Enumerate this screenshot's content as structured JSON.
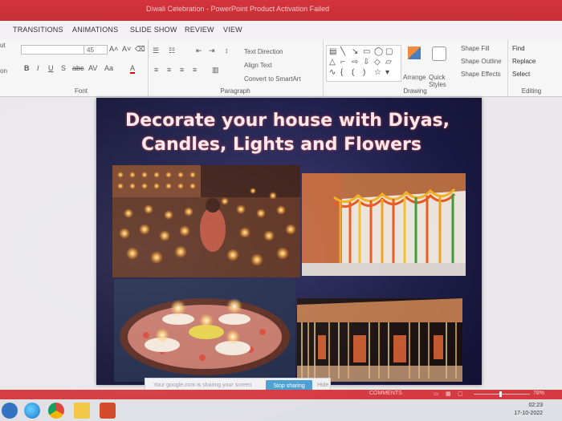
{
  "titlebar": {
    "title": "Diwali Celebration - PowerPoint Product Activation Failed"
  },
  "tabs": [
    "TRANSITIONS",
    "ANIMATIONS",
    "SLIDE SHOW",
    "REVIEW",
    "VIEW"
  ],
  "window": {
    "help": "?",
    "restore": "▢"
  },
  "ribbon": {
    "font": {
      "label": "Font",
      "font_size": "45",
      "buttons": [
        "B",
        "I",
        "U",
        "S",
        "abc",
        "AV",
        "Aa",
        "A"
      ],
      "grow": "A˄",
      "shrink": "A˅"
    },
    "paragraph": {
      "label": "Paragraph",
      "text_direction": "Text Direction",
      "align_text": "Align Text",
      "convert_smartart": "Convert to SmartArt"
    },
    "drawing": {
      "label": "Drawing",
      "arrange": "Arrange",
      "quick_styles": "Quick Styles",
      "shape_fill": "Shape Fill",
      "shape_outline": "Shape Outline",
      "shape_effects": "Shape Effects"
    },
    "editing": {
      "label": "Editing",
      "find": "Find",
      "replace": "Replace",
      "select": "Select"
    },
    "left_cut": [
      "ut",
      "on"
    ]
  },
  "slide": {
    "title_line1": "Decorate your house with Diyas,",
    "title_line2": "Candles, Lights and Flowers",
    "colors": {
      "background": "#1b1a44",
      "title_text": "#fbe9ea"
    }
  },
  "sharing": {
    "message": "Your google.com is sharing your screen",
    "stop_button": "Stop sharing",
    "hide_button": "Hide"
  },
  "statusbar": {
    "comments": "COMMENTS",
    "zoom": "78%"
  },
  "taskbar": {
    "time": "02:23",
    "date": "17-10-2022"
  },
  "colors": {
    "accent": "#c52f36",
    "share_button": "#4a9fd1"
  }
}
